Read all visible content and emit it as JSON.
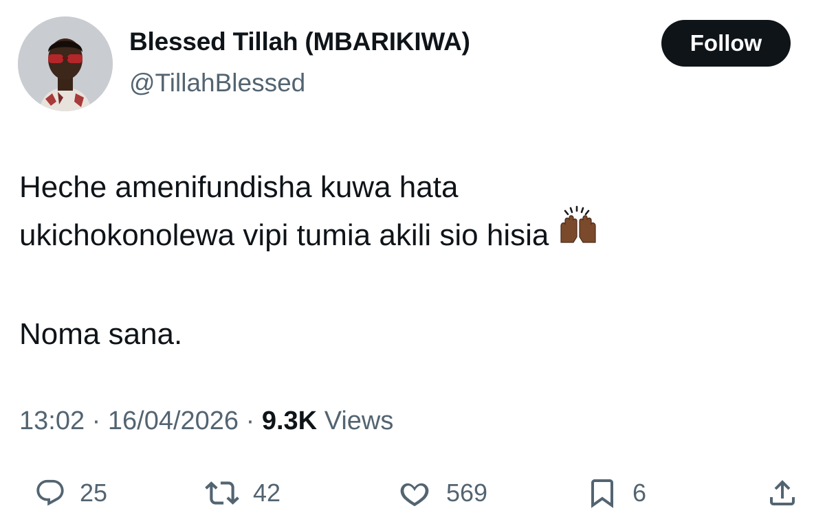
{
  "author": {
    "name": "Blessed Tillah (MBARIKIWA)",
    "handle": "@TillahBlessed"
  },
  "header": {
    "follow_label": "Follow"
  },
  "tweet": {
    "lines": [
      "Heche amenifundisha kuwa hata",
      "ukichokonolewa vipi tumia akili sio hisia",
      "Noma sana."
    ],
    "emoji": "raising-hands-emoji"
  },
  "meta": {
    "time": "13:02",
    "separator": " · ",
    "date": "16/04/2026",
    "views_count": "9.3K",
    "views_label": "Views"
  },
  "actions": {
    "reply_count": "25",
    "retweet_count": "42",
    "like_count": "569",
    "bookmark_count": "6"
  },
  "colors": {
    "text": "#0f1419",
    "secondary": "#536471",
    "follow_bg": "#0f1419"
  },
  "icons": [
    "reply-icon",
    "retweet-icon",
    "like-icon",
    "bookmark-icon",
    "share-icon"
  ]
}
